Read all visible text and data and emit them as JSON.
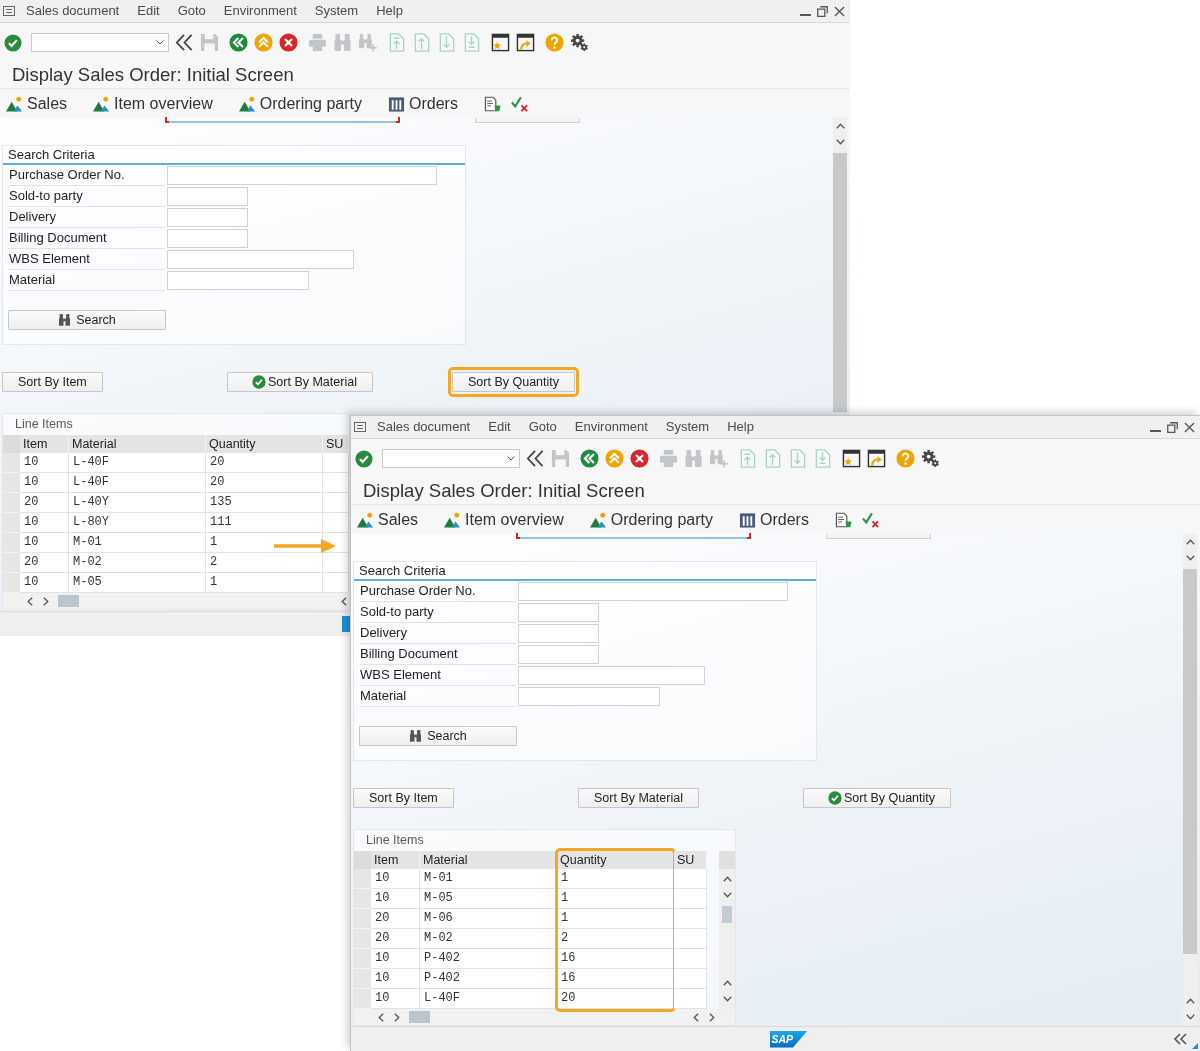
{
  "windows": [
    {
      "active": false,
      "menu": [
        "Sales document",
        "Edit",
        "Goto",
        "Environment",
        "System",
        "Help"
      ],
      "toolbar": [
        {
          "kind": "enter",
          "disabled": false
        },
        {
          "kind": "command-field",
          "disabled": false
        },
        {
          "kind": "collapse",
          "disabled": false
        },
        {
          "kind": "save",
          "disabled": true
        },
        {
          "kind": "back",
          "disabled": false
        },
        {
          "kind": "exit",
          "disabled": false
        },
        {
          "kind": "cancel",
          "disabled": false
        },
        {
          "kind": "print",
          "disabled": true
        },
        {
          "kind": "find",
          "disabled": true
        },
        {
          "kind": "find-next",
          "disabled": true
        },
        {
          "kind": "first-page",
          "disabled": true
        },
        {
          "kind": "previous-page",
          "disabled": true
        },
        {
          "kind": "next-page",
          "disabled": true
        },
        {
          "kind": "last-page",
          "disabled": true
        },
        {
          "kind": "new-session",
          "disabled": false
        },
        {
          "kind": "shortcut",
          "disabled": false
        },
        {
          "kind": "help",
          "disabled": false
        },
        {
          "kind": "settings",
          "disabled": false
        }
      ],
      "title": "Display Sales Order: Initial Screen",
      "app_toolbar": [
        {
          "kind": "mountain",
          "label": "Sales"
        },
        {
          "kind": "mountain",
          "label": "Item overview"
        },
        {
          "kind": "mountain",
          "label": "Ordering party"
        },
        {
          "kind": "columns",
          "label": "Orders"
        },
        {
          "kind": "document"
        },
        {
          "kind": "check-cross"
        }
      ],
      "search_criteria": {
        "title": "Search Criteria",
        "fields": [
          "Purchase Order No.",
          "Sold-to party",
          "Delivery",
          "Billing Document",
          "WBS Element",
          "Material"
        ],
        "button": "Search"
      },
      "sort_buttons": [
        {
          "label": "Sort By Item",
          "selected": false,
          "highlighted": false
        },
        {
          "label": "Sort By Material",
          "selected": true,
          "highlighted": false
        },
        {
          "label": "Sort By Quantity",
          "selected": false,
          "highlighted": true
        }
      ],
      "line_items": {
        "title": "Line Items",
        "columns": [
          {
            "label": "Item",
            "highlighted": false
          },
          {
            "label": "Material",
            "highlighted": false
          },
          {
            "label": "Quantity",
            "highlighted": false
          },
          {
            "label": "SU",
            "highlighted": false
          }
        ],
        "rows": [
          [
            "10",
            "L-40F",
            "20"
          ],
          [
            "10",
            "L-40F",
            "20"
          ],
          [
            "20",
            "L-40Y",
            "135"
          ],
          [
            "10",
            "L-80Y",
            "111"
          ],
          [
            "10",
            "M-01",
            "1"
          ],
          [
            "20",
            "M-02",
            "2"
          ],
          [
            "10",
            "M-05",
            "1"
          ]
        ]
      },
      "status_bar": {
        "logo": {
          "kind": "cut"
        }
      }
    },
    {
      "active": true,
      "menu": [
        "Sales document",
        "Edit",
        "Goto",
        "Environment",
        "System",
        "Help"
      ],
      "toolbar": [
        {
          "kind": "enter",
          "disabled": false
        },
        {
          "kind": "command-field",
          "disabled": false
        },
        {
          "kind": "collapse",
          "disabled": false
        },
        {
          "kind": "save",
          "disabled": true
        },
        {
          "kind": "back",
          "disabled": false
        },
        {
          "kind": "exit",
          "disabled": false
        },
        {
          "kind": "cancel",
          "disabled": false
        },
        {
          "kind": "print",
          "disabled": true
        },
        {
          "kind": "find",
          "disabled": true
        },
        {
          "kind": "find-next",
          "disabled": true
        },
        {
          "kind": "first-page",
          "disabled": true
        },
        {
          "kind": "previous-page",
          "disabled": true
        },
        {
          "kind": "next-page",
          "disabled": true
        },
        {
          "kind": "last-page",
          "disabled": true
        },
        {
          "kind": "new-session",
          "disabled": false
        },
        {
          "kind": "shortcut",
          "disabled": false
        },
        {
          "kind": "help",
          "disabled": false
        },
        {
          "kind": "settings",
          "disabled": false
        }
      ],
      "title": "Display Sales Order: Initial Screen",
      "app_toolbar": [
        {
          "kind": "mountain",
          "label": "Sales"
        },
        {
          "kind": "mountain",
          "label": "Item overview"
        },
        {
          "kind": "mountain",
          "label": "Ordering party"
        },
        {
          "kind": "columns",
          "label": "Orders"
        },
        {
          "kind": "document"
        },
        {
          "kind": "check-cross"
        }
      ],
      "search_criteria": {
        "title": "Search Criteria",
        "fields": [
          "Purchase Order No.",
          "Sold-to party",
          "Delivery",
          "Billing Document",
          "WBS Element",
          "Material"
        ],
        "button": "Search"
      },
      "sort_buttons": [
        {
          "label": "Sort By Item",
          "selected": false,
          "highlighted": false
        },
        {
          "label": "Sort By Material",
          "selected": false,
          "highlighted": false
        },
        {
          "label": "Sort By Quantity",
          "selected": true,
          "highlighted": false
        }
      ],
      "line_items": {
        "title": "Line Items",
        "columns": [
          {
            "label": "Item",
            "highlighted": false
          },
          {
            "label": "Material",
            "highlighted": false
          },
          {
            "label": "Quantity",
            "highlighted": true
          },
          {
            "label": "SU",
            "highlighted": false
          }
        ],
        "rows": [
          [
            "10",
            "M-01",
            "1"
          ],
          [
            "10",
            "M-05",
            "1"
          ],
          [
            "20",
            "M-06",
            "1"
          ],
          [
            "20",
            "M-02",
            "2"
          ],
          [
            "10",
            "P-402",
            "16"
          ],
          [
            "10",
            "P-402",
            "16"
          ],
          [
            "10",
            "L-40F",
            "20"
          ]
        ]
      },
      "status_bar": {
        "logo": {
          "kind": "full",
          "text": "SAP"
        }
      }
    }
  ],
  "annotations": [
    {
      "kind": "arrow"
    }
  ]
}
